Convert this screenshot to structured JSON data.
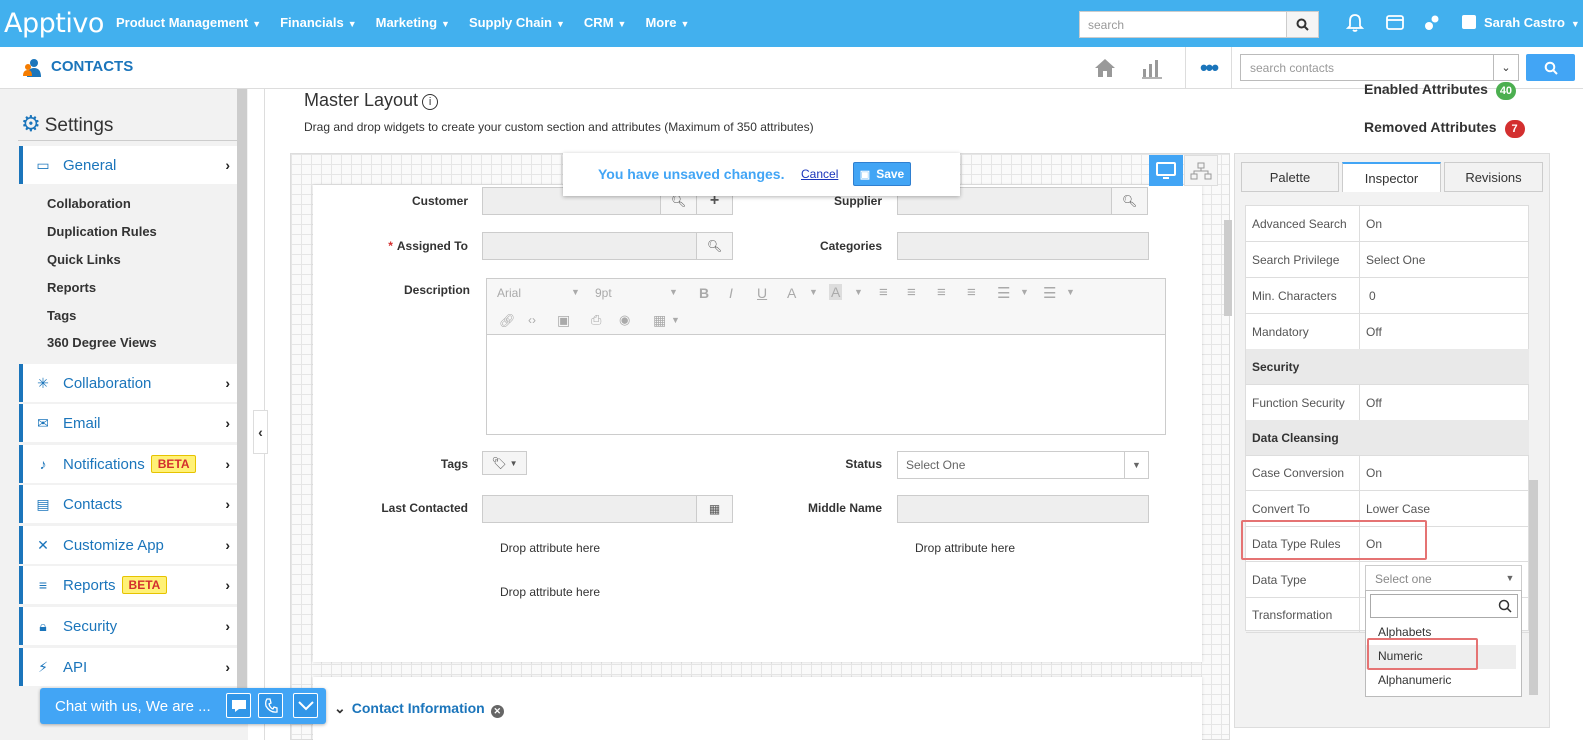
{
  "brand": {
    "logo": "Apptivo"
  },
  "topnav": [
    {
      "label": "Product Management"
    },
    {
      "label": "Financials"
    },
    {
      "label": "Marketing"
    },
    {
      "label": "Supply Chain"
    },
    {
      "label": "CRM"
    },
    {
      "label": "More"
    }
  ],
  "top_search": {
    "placeholder": "search"
  },
  "user": {
    "name": "Sarah Castro"
  },
  "app": {
    "title": "CONTACTS",
    "search_placeholder": "search contacts"
  },
  "sidebar": {
    "title": "Settings",
    "general": {
      "label": "General"
    },
    "subitems": [
      "Collaboration",
      "Duplication Rules",
      "Quick Links",
      "Reports",
      "Tags",
      "360 Degree Views"
    ],
    "items": [
      {
        "label": "Collaboration"
      },
      {
        "label": "Email"
      },
      {
        "label": "Notifications",
        "badge": "BETA"
      },
      {
        "label": "Contacts"
      },
      {
        "label": "Customize App"
      },
      {
        "label": "Reports",
        "badge": "BETA"
      },
      {
        "label": "Security"
      },
      {
        "label": "API"
      }
    ]
  },
  "main": {
    "title": "Master Layout",
    "subtitle": "Drag and drop widgets to create your custom section and attributes (Maximum of 350 attributes)",
    "enabled_attributes": {
      "label": "Enabled Attributes",
      "count": "40"
    },
    "removed_attributes": {
      "label": "Removed Attributes",
      "count": "7"
    }
  },
  "unsaved": {
    "message": "You have unsaved changes.",
    "cancel": "Cancel",
    "save": "Save"
  },
  "form": {
    "customer": "Customer",
    "supplier": "Supplier",
    "assigned_to": "Assigned To",
    "categories": "Categories",
    "description": "Description",
    "font": "Arial",
    "size": "9pt",
    "tags": "Tags",
    "status": "Status",
    "status_value": "Select One",
    "last_contacted": "Last Contacted",
    "middle_name": "Middle Name",
    "drop1": "Drop attribute here",
    "drop2": "Drop attribute here",
    "drop3": "Drop attribute here",
    "section": "Contact Information"
  },
  "inspector": {
    "tabs": [
      "Palette",
      "Inspector",
      "Revisions"
    ],
    "rows": [
      {
        "key": "Advanced Search",
        "value": "On"
      },
      {
        "key": "Search Privilege",
        "value": "Select One"
      },
      {
        "key": "Min. Characters",
        "value": "0"
      },
      {
        "key": "Mandatory",
        "value": "Off"
      },
      {
        "section": "Security"
      },
      {
        "key": "Function Security",
        "value": "Off"
      },
      {
        "section": "Data Cleansing"
      },
      {
        "key": "Case Conversion",
        "value": "On"
      },
      {
        "key": "Convert To",
        "value": "Lower Case"
      },
      {
        "key": "Data Type Rules",
        "value": "On"
      },
      {
        "key": "Data Type",
        "value": ""
      },
      {
        "key": "Transformation",
        "value": ""
      }
    ],
    "data_type_placeholder": "Select one",
    "options": [
      "Alphabets",
      "Numeric",
      "Alphanumeric"
    ]
  },
  "chat": {
    "label": "Chat with us, We are ..."
  },
  "colors": {
    "topbar": "#42b0ee",
    "accent": "#1b75bb",
    "badge_green": "#4caf50",
    "badge_red": "#d32f2f",
    "highlight": "#e57373"
  }
}
